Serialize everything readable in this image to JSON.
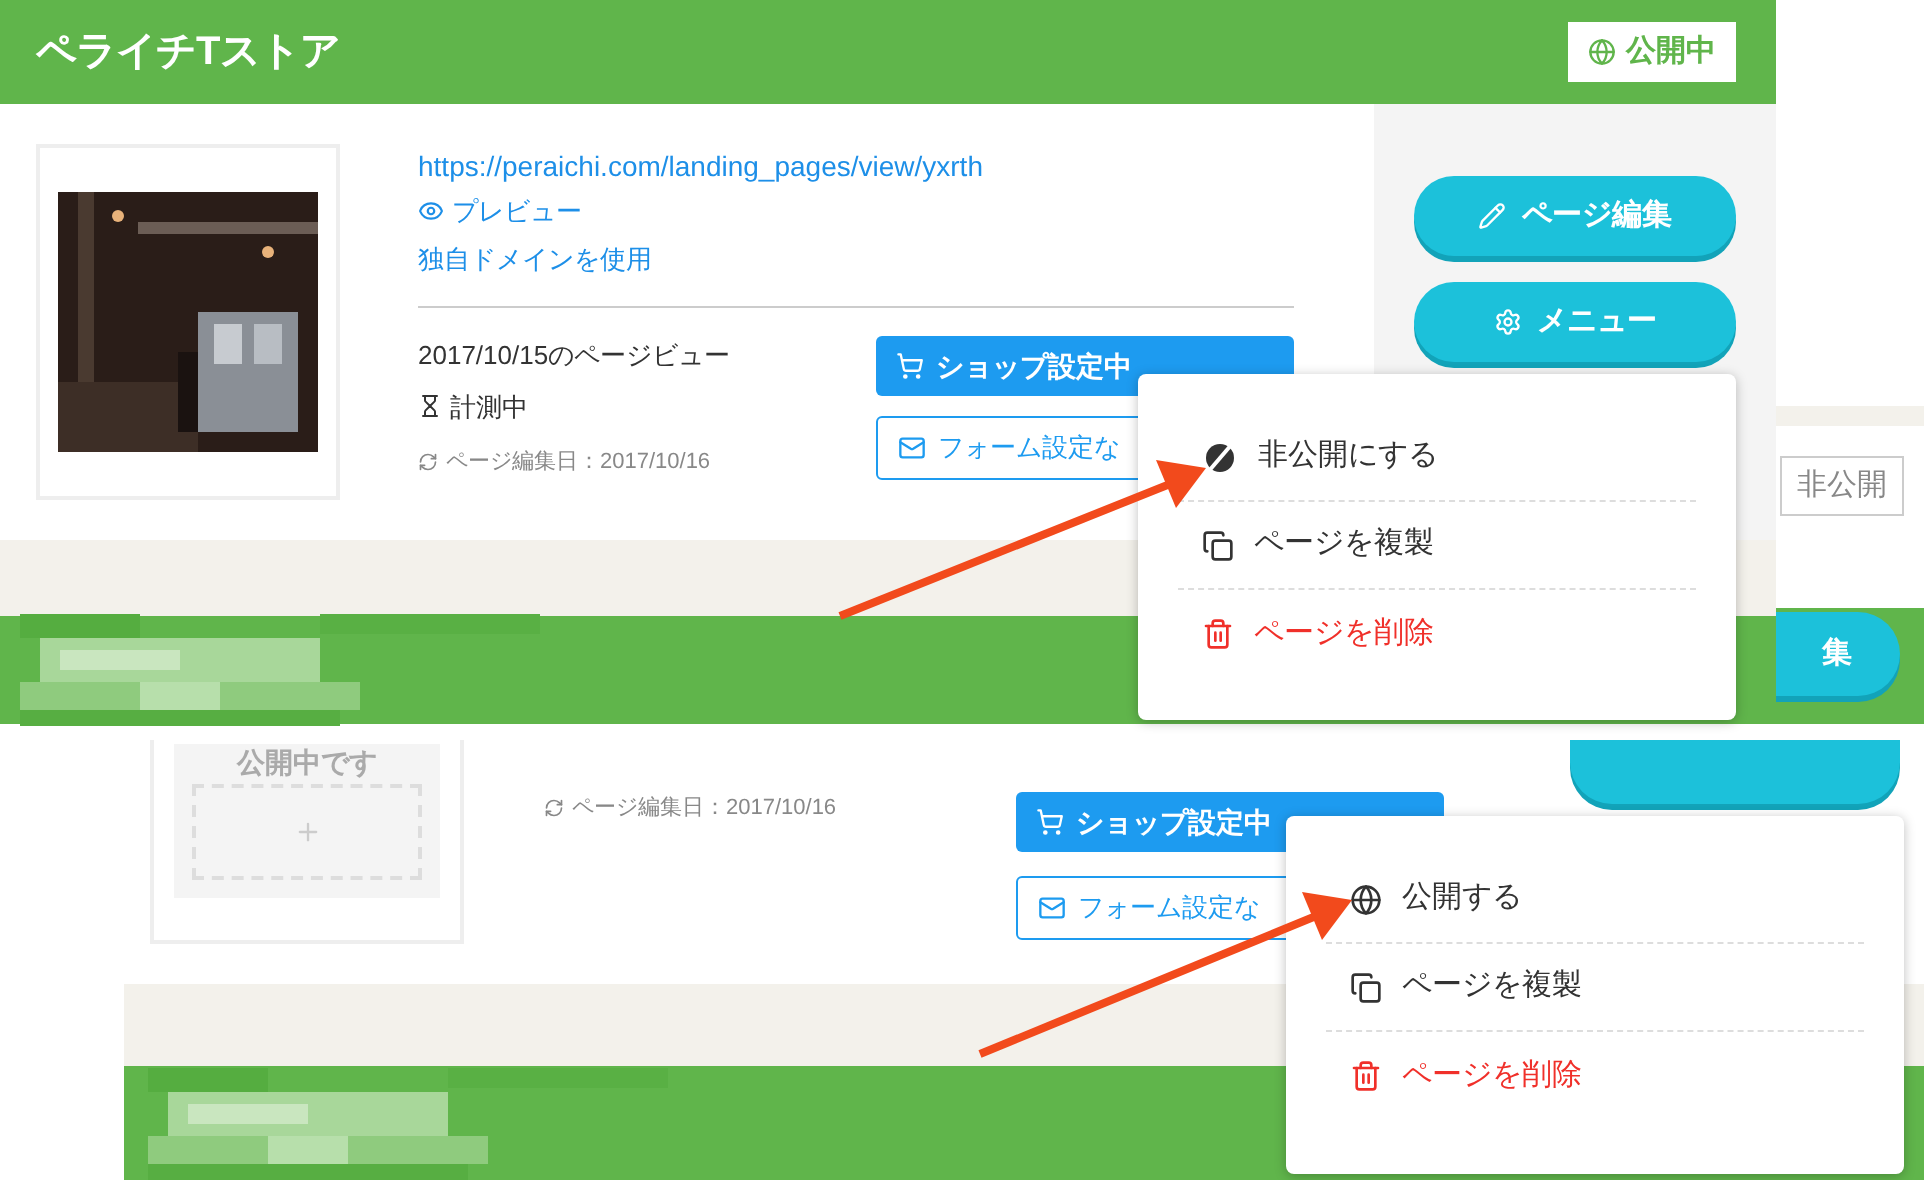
{
  "top_card": {
    "title": "ペライチTストア",
    "status_badge": "公開中",
    "url": "https://peraichi.com/landing_pages/view/yxrth",
    "preview_link": "プレビュー",
    "domain_link": "独自ドメインを使用",
    "pageview_label": "2017/10/15のページビュー",
    "pageview_value": "計測中",
    "edited": "ページ編集日：2017/10/16",
    "shop_button": "ショップ設定中",
    "form_button": "フォーム設定な",
    "edit_button": "ページ編集",
    "menu_button": "メニュー",
    "menu": [
      {
        "kind": "unpublish",
        "label": "非公開にする"
      },
      {
        "kind": "duplicate",
        "label": "ページを複製"
      },
      {
        "kind": "delete",
        "label": "ページを削除"
      }
    ]
  },
  "bottom_card": {
    "status_badge": "非公開",
    "edit_button": "集",
    "thumbnail_text": "公開中です",
    "edited": "ページ編集日：2017/10/16",
    "shop_button": "ショップ設定中",
    "form_button": "フォーム設定な",
    "menu": [
      {
        "kind": "publish",
        "label": "公開する"
      },
      {
        "kind": "duplicate",
        "label": "ページを複製"
      },
      {
        "kind": "delete",
        "label": "ページを削除"
      }
    ]
  }
}
